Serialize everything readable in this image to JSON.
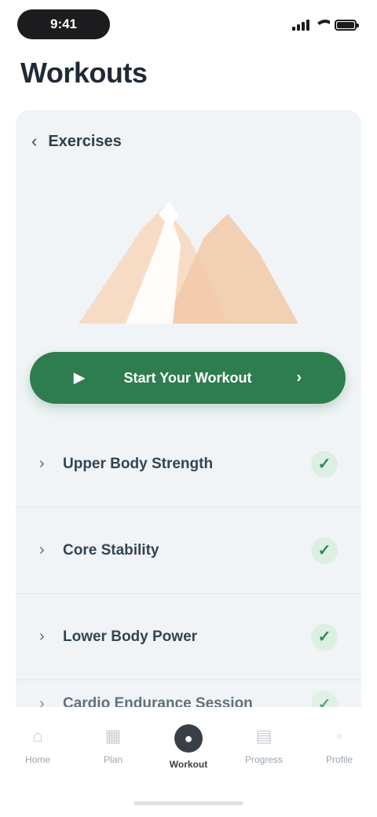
{
  "status_bar": {
    "time": "9:41",
    "icons": [
      "signal-icon",
      "wifi-icon",
      "battery-icon"
    ]
  },
  "page": {
    "title": "Workouts"
  },
  "card": {
    "back_label": "Exercises"
  },
  "illustration": {
    "icon": "mountain-illustration"
  },
  "cta": {
    "label": "Start Your Workout",
    "icon_left": "play-icon",
    "icon_right": "arrow-right-icon"
  },
  "list": {
    "items": [
      {
        "label": "Upper Body Strength",
        "status": "completed"
      },
      {
        "label": "Core Stability",
        "status": "completed"
      },
      {
        "label": "Lower Body Power",
        "status": "completed"
      },
      {
        "label": "Cardio Endurance Session",
        "status": "completed"
      }
    ]
  },
  "tab_bar": {
    "tabs": [
      {
        "label": "Home",
        "icon": "home-icon",
        "active": false
      },
      {
        "label": "Plan",
        "icon": "calendar-icon",
        "active": false
      },
      {
        "label": "Workout",
        "icon": "dumbbell-icon",
        "active": true
      },
      {
        "label": "Progress",
        "icon": "chart-icon",
        "active": false
      },
      {
        "label": "Profile",
        "icon": "user-icon",
        "active": false
      }
    ]
  },
  "colors": {
    "accent": "#2e7d4f",
    "card_bg": "#f0f4f6",
    "check_bg": "#dcefe3",
    "illustration_peach": "#f2c9a8"
  }
}
